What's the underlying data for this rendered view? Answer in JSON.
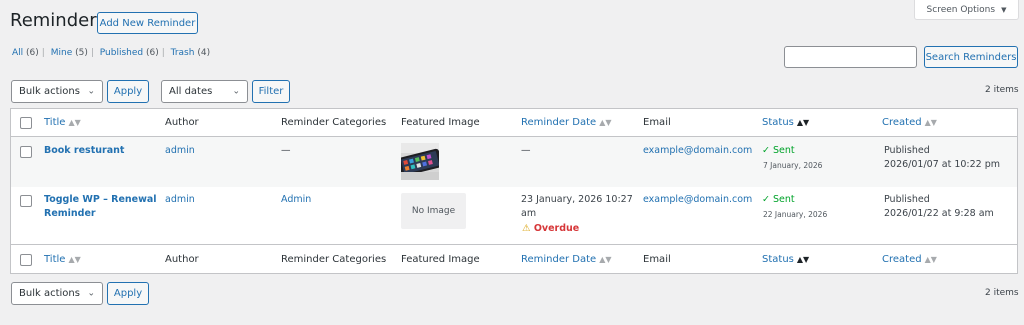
{
  "page": {
    "title": "Reminders",
    "add_new_label": "Add New Reminder",
    "screen_options_label": "Screen Options",
    "screen_options_caret": "▼"
  },
  "views": [
    {
      "label": "All",
      "count": "(6)"
    },
    {
      "label": "Mine",
      "count": "(5)"
    },
    {
      "label": "Published",
      "count": "(6)"
    },
    {
      "label": "Trash",
      "count": "(4)"
    }
  ],
  "search": {
    "button_label": "Search Reminders",
    "value": "",
    "placeholder": ""
  },
  "top_nav": {
    "bulk_actions_selected": "Bulk actions",
    "apply_label": "Apply",
    "dates_selected": "All dates",
    "filter_label": "Filter",
    "items_count": "2 items"
  },
  "bottom_nav": {
    "bulk_actions_selected": "Bulk actions",
    "apply_label": "Apply",
    "items_count": "2 items"
  },
  "columns": {
    "title": "Title",
    "author": "Author",
    "categories": "Reminder Categories",
    "featured_image": "Featured Image",
    "reminder_date": "Reminder Date",
    "email": "Email",
    "status": "Status",
    "created": "Created"
  },
  "rows": [
    {
      "title": "Book resturant",
      "author": "admin",
      "categories": "—",
      "featured_image": "phone-photo",
      "reminder_date": "—",
      "email": "example@domain.com",
      "status": "✓ Sent",
      "status_date": "7 January, 2026",
      "created_status": "Published",
      "created_date": "2026/01/07 at 10:22 pm"
    },
    {
      "title_line1": "Toggle WP – Renewal",
      "title_line2": "Reminder",
      "author": "admin",
      "categories": "Admin",
      "no_image_label": "No Image",
      "reminder_date_line1": "23 January, 2026 10:27",
      "reminder_date_line2": "am",
      "overdue_label": "Overdue",
      "email": "example@domain.com",
      "status": "✓ Sent",
      "status_date": "22 January, 2026",
      "created_status": "Published",
      "created_date": "2026/01/22 at 9:28 am"
    }
  ],
  "colors": {
    "link": "#2271b1",
    "sent": "#00a32a",
    "overdue": "#d63638",
    "background": "#f0f0f1"
  }
}
